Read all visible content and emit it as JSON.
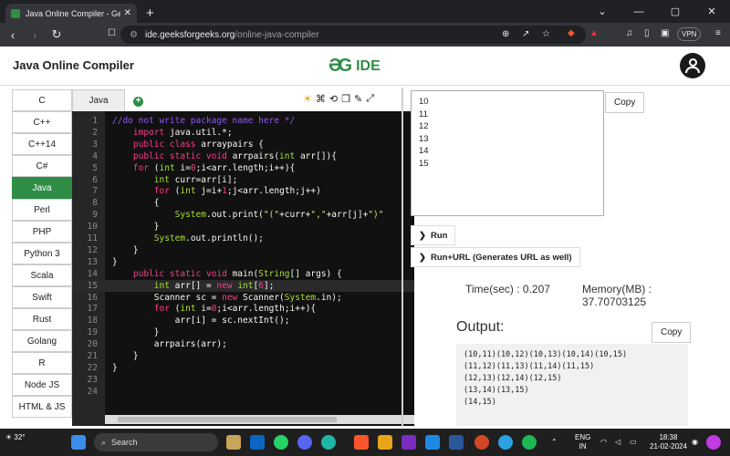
{
  "browser": {
    "tab_title": "Java Online Compiler - Geeksfor",
    "url_domain": "ide.geeksforgeeks.org",
    "url_path": "/online-java-compiler",
    "vpn_label": "VPN"
  },
  "header": {
    "title": "Java Online Compiler",
    "logo_text": "IDE"
  },
  "languages": [
    "C",
    "C++",
    "C++14",
    "C#",
    "Java",
    "Perl",
    "PHP",
    "Python 3",
    "Scala",
    "Swift",
    "Rust",
    "Golang",
    "R",
    "Node JS",
    "HTML & JS"
  ],
  "active_language": "Java",
  "editor": {
    "tab_label": "Java",
    "line_numbers": [
      "1",
      "2",
      "3",
      "4",
      "5",
      "6",
      "7",
      "8",
      "9",
      "10",
      "11",
      "12",
      "13",
      "14",
      "15",
      "16",
      "17",
      "18",
      "19",
      "20",
      "21",
      "22",
      "23",
      "24"
    ],
    "highlighted_line": "15"
  },
  "input": {
    "lines": [
      "10",
      "11",
      "12",
      "13",
      "14",
      "15"
    ],
    "copy_label": "Copy"
  },
  "actions": {
    "run_label": "Run",
    "run_url_label": "Run+URL (Generates URL as well)"
  },
  "metrics": {
    "time_label": "Time(sec) : 0.207",
    "memory_label": "Memory(MB) :",
    "memory_value": "37.70703125"
  },
  "output": {
    "label": "Output:",
    "copy_label": "Copy",
    "lines": [
      "(10,11)(10,12)(10,13)(10,14)(10,15)",
      "(11,12)(11,13)(11,14)(11,15)",
      "(12,13)(12,14)(12,15)",
      "(13,14)(13,15)",
      "(14,15)"
    ]
  },
  "taskbar": {
    "weather": "32°",
    "search_placeholder": "Search",
    "lang_top": "ENG",
    "lang_bottom": "IN",
    "time": "18:38",
    "date": "21-02-2024"
  }
}
